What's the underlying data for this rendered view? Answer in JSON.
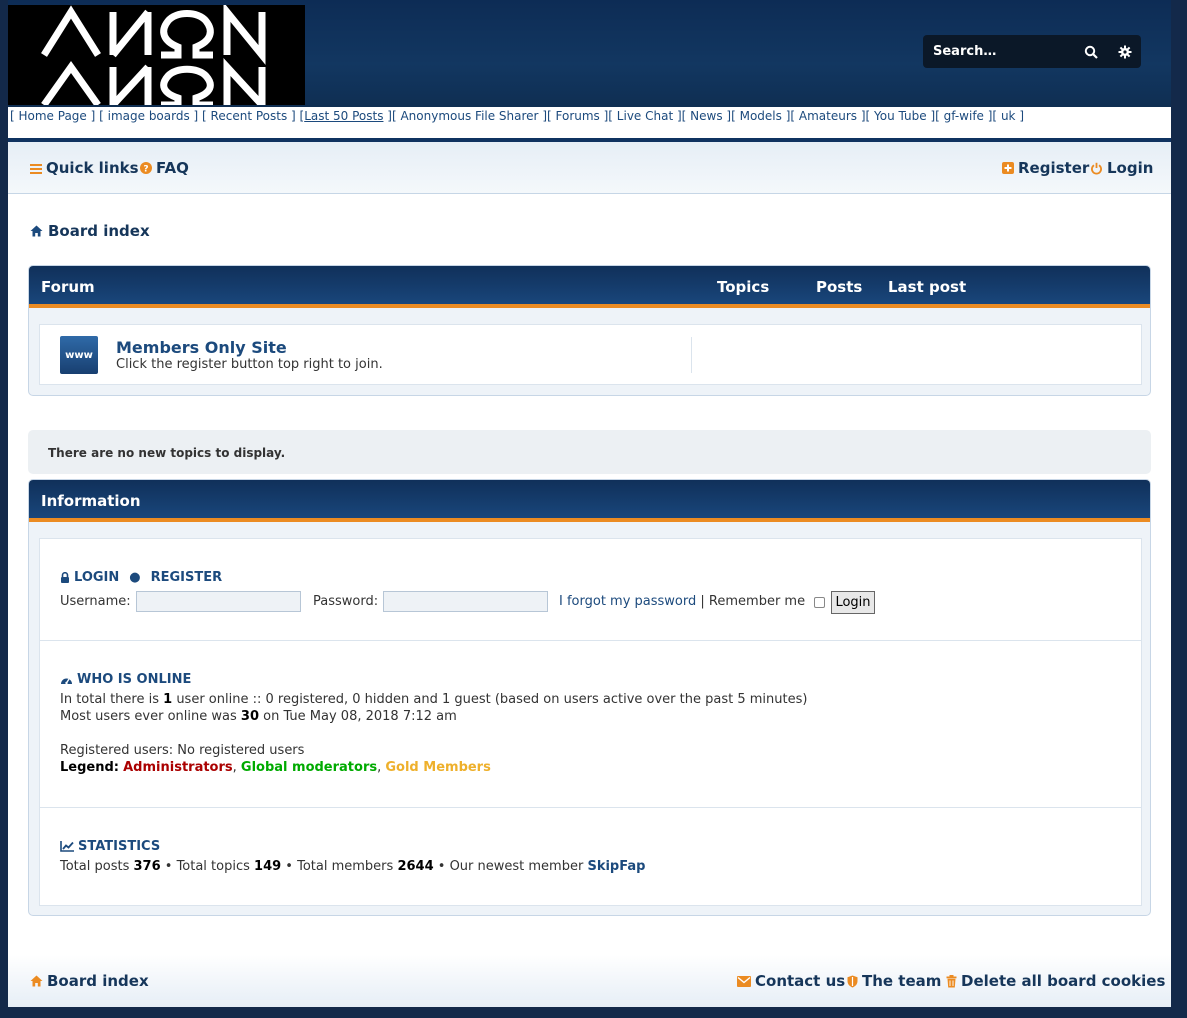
{
  "header": {
    "search_placeholder": "Search…",
    "icons": {
      "search": "search-icon",
      "advanced": "gear-icon"
    }
  },
  "topnav": {
    "items": [
      "Home Page",
      "image boards",
      "Recent Posts",
      "Last 50 Posts",
      "Anonymous File Sharer",
      "Forums",
      "Live Chat",
      "News",
      "Models",
      "Amateurs",
      "You Tube",
      "gf-wife",
      "uk"
    ]
  },
  "navbar": {
    "quick_links": "Quick links",
    "faq": "FAQ",
    "register": "Register",
    "login": "Login"
  },
  "breadcrumb": {
    "board_index": "Board index"
  },
  "forum_table": {
    "col_forum": "Forum",
    "col_topics": "Topics",
    "col_posts": "Posts",
    "col_last_post": "Last post",
    "rows": [
      {
        "icon_label": "www",
        "title": "Members Only Site",
        "desc": "Click the register button top right to join."
      }
    ]
  },
  "notice": "There are no new topics to display.",
  "info": {
    "title": "Information",
    "login_section": {
      "login_label": "LOGIN",
      "register_label": "REGISTER",
      "username_label": "Username:",
      "password_label": "Password:",
      "forgot": "I forgot my password",
      "remember": "Remember me",
      "login_button": "Login"
    },
    "online": {
      "title": "WHO IS ONLINE",
      "line1_a": "In total there is",
      "line1_count": "1",
      "line1_b": "user online :: 0 registered, 0 hidden and 1 guest (based on users active over the past 5 minutes)",
      "line2_a": "Most users ever online was",
      "line2_count": "30",
      "line2_b": "on Tue May 08, 2018 7:12 am",
      "registered": "Registered users: No registered users",
      "legend_label": "Legend:",
      "legend_admin": "Administrators",
      "legend_gmod": "Global moderators",
      "legend_gold": "Gold Members"
    },
    "stats": {
      "title": "STATISTICS",
      "posts_label": "Total posts",
      "posts": "376",
      "topics_label": "Total topics",
      "topics": "149",
      "members_label": "Total members",
      "members": "2644",
      "newest_label": "Our newest member",
      "newest": "SkipFap"
    }
  },
  "footer": {
    "board_index": "Board index",
    "contact": "Contact us",
    "team": "The team",
    "delete_cookies": "Delete all board cookies"
  },
  "colors": {
    "header_bg": "#123761",
    "accent": "#eb8b22",
    "link": "#1c4a7d",
    "admin": "#aa0000",
    "global_mod": "#00aa00",
    "gold_member": "#eeb02c"
  }
}
